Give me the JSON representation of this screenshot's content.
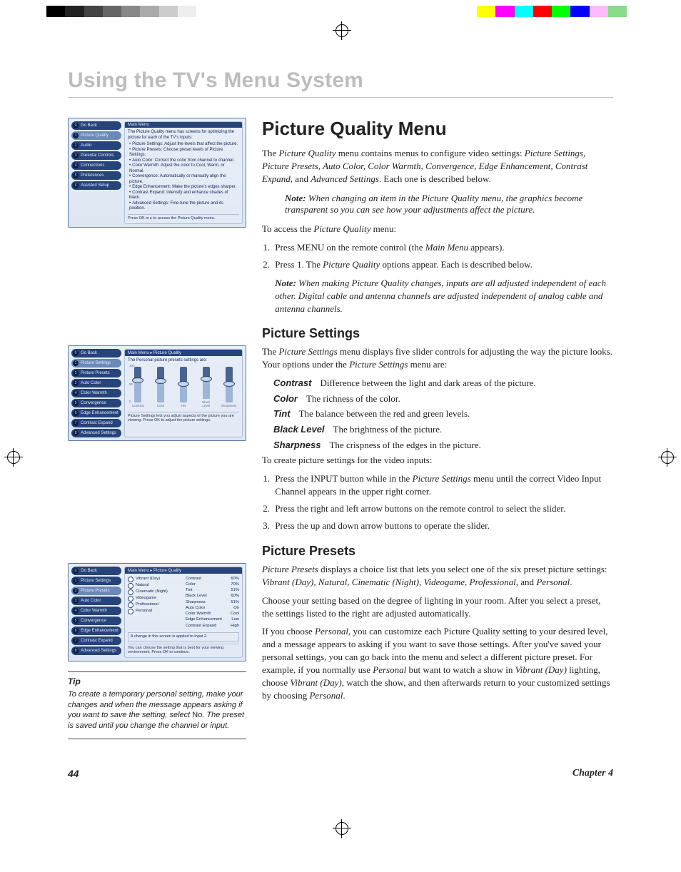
{
  "chapter_heading": "Using the TV's Menu System",
  "h1": "Picture Quality Menu",
  "intro": {
    "pre": "The ",
    "m1": "Picture Quality",
    "mid1": " menu contains menus to configure video settings: ",
    "m2": "Picture Settings, Picture Presets, Auto Color, Color Warmth, Convergence, Edge Enhancement, Contrast Expand,",
    "mid2": " and ",
    "m3": "Advanced Settings",
    "end": ". Each one is described below."
  },
  "note1_label": "Note:",
  "note1": "When changing an item in the Picture Quality menu, the graphics become transparent so you can see how your adjustments affect the picture.",
  "access_line_pre": "To access the ",
  "access_line_m": "Picture Quality",
  "access_line_post": " menu:",
  "steps1": {
    "s1_pre": "Press MENU on the remote control (the ",
    "s1_m": "Main Menu",
    "s1_post": " appears).",
    "s2_pre": "Press 1. The ",
    "s2_m": "Picture Quality",
    "s2_post": " options appear. Each is described below."
  },
  "note2_label": "Note:",
  "note2": "When making Picture Quality changes, inputs are all adjusted independent of each other. Digital cable and antenna channels are adjusted independent of analog cable and antenna channels.",
  "h2a": "Picture Settings",
  "ps_p1_pre": "The ",
  "ps_p1_m": "Picture Settings",
  "ps_p1_mid": " menu displays five slider controls for adjusting the way the picture looks. Your options under the ",
  "ps_p1_m2": "Picture Settings",
  "ps_p1_post": " menu are:",
  "defs": {
    "contrast_t": "Contrast",
    "contrast_d": "Difference between the light and dark areas of the picture.",
    "color_t": "Color",
    "color_d": "The richness of the color.",
    "tint_t": "Tint",
    "tint_d": "The balance between the red and green levels.",
    "black_t": "Black Level",
    "black_d": "The brightness of the picture.",
    "sharp_t": "Sharpness",
    "sharp_d": "The crispness of the edges in the picture."
  },
  "ps_line2": "To create picture settings for the video inputs:",
  "steps2": {
    "s1_pre": "Press the INPUT button while in the ",
    "s1_m": "Picture Settings",
    "s1_post": " menu until the correct Video Input Channel appears in the upper right corner.",
    "s2": "Press the right and left arrow buttons on the remote control to select the slider.",
    "s3": "Press the up and down arrow buttons to operate the slider."
  },
  "h2b": "Picture Presets",
  "pp_p1_pre": "",
  "pp_p1_m": "Picture Presets",
  "pp_p1_mid": " displays a choice list that lets you select one of the six preset picture settings: ",
  "pp_p1_m2": "Vibrant (Day), Natural, Cinematic (Night), Videogame, Professional,",
  "pp_p1_mid2": " and ",
  "pp_p1_m3": "Personal",
  "pp_p1_end": ".",
  "pp_p2": "Choose your setting based on the degree of lighting in your room. After you select a preset, the settings listed to the right are adjusted automatically.",
  "pp_p3_a": "If you choose ",
  "pp_p3_m1": "Personal",
  "pp_p3_b": ", you can customize each Picture Quality setting to your desired level, and a message appears to asking if you want to save those settings. After you've saved your personal settings, you can go back into the menu and select a different picture preset. For example, if you normally use ",
  "pp_p3_m2": "Personal",
  "pp_p3_c": " but want to watch a show in ",
  "pp_p3_m3": "Vibrant (Day)",
  "pp_p3_d": " lighting, choose ",
  "pp_p3_m4": "Vibrant (Day)",
  "pp_p3_e": ", watch the show, and then afterwards return to your customized settings by choosing ",
  "pp_p3_m5": "Personal",
  "pp_p3_f": ".",
  "tip_title": "Tip",
  "tip_body_a": "To create a temporary personal setting, make your changes and when the message appears asking if you want to save the setting, select ",
  "tip_body_no": "No",
  "tip_body_b": ". The preset is saved until you change the channel or input.",
  "panel1": {
    "breadcrumb": "Main Menu",
    "nav": [
      "Go Back",
      "Picture Quality",
      "Audio",
      "Parental Controls",
      "Connections",
      "Preferences",
      "Assisted Setup"
    ],
    "info_line": "The Picture Quality menu has screens for optimizing the picture for each of the TV's inputs:",
    "bullets": [
      "Picture Settings: Adjust the levels that affect the picture.",
      "Picture Presets: Choose preset levels of Picture Settings.",
      "Auto Color: Correct the color from channel to channel.",
      "Color Warmth: Adjust the color to Cool, Warm, or Normal.",
      "Convergence: Automatically or manually align the picture.",
      "Edge Enhancement: Make the picture's edges sharper.",
      "Contrast Expand: Intensify and enhance shades of black.",
      "Advanced Settings: Fine-tune the picture and its position."
    ],
    "footer": "Press OK or ▸ to access the Picture Quality menu."
  },
  "panel2": {
    "breadcrumb": "Main Menu ▸ Picture Quality",
    "nav": [
      "Go Back",
      "Picture Settings",
      "Picture Presets",
      "Auto Color",
      "Color Warmth",
      "Convergence",
      "Edge Enhancement",
      "Contrast Expand",
      "Advanced Settings"
    ],
    "info_line": "The Personal picture presets settings are:",
    "sliders": [
      {
        "label": "Contrast",
        "value": 60
      },
      {
        "label": "Color",
        "value": 59
      },
      {
        "label": "Tint",
        "value": 50
      },
      {
        "label": "Black Level",
        "value": 60
      },
      {
        "label": "Sharpness",
        "value": 50
      }
    ],
    "axis_top": "100",
    "axis_mid": "50",
    "axis_bot": "0",
    "footer": "Picture Settings lets you adjust aspects of the picture you are viewing. Press OK to adjust the picture settings."
  },
  "panel3": {
    "breadcrumb": "Main Menu ▸ Picture Quality",
    "nav": [
      "Go Back",
      "Picture Settings",
      "Picture Presets",
      "Auto Color",
      "Color Warmth",
      "Convergence",
      "Edge Enhancement",
      "Contrast Expand",
      "Advanced Settings"
    ],
    "presets": [
      "Vibrant (Day)",
      "Natural",
      "Cinematic (Night)",
      "Videogame",
      "Professional",
      "Personal"
    ],
    "values": [
      [
        "Contrast",
        "60%"
      ],
      [
        "Color",
        "70%"
      ],
      [
        "Tint",
        "51%"
      ],
      [
        "Black Level",
        "60%"
      ],
      [
        "Sharpness",
        "51%"
      ],
      [
        "Auto Color",
        "On"
      ],
      [
        "Color Warmth",
        "Cool"
      ],
      [
        "Edge Enhancement",
        "Low"
      ],
      [
        "Contrast Expand",
        "High"
      ]
    ],
    "foot1": "A change in this screen is applied to Input 2.",
    "foot2": "You can choose the setting that is best for your viewing environment. Press OK to continue."
  },
  "footer": {
    "page": "44",
    "chapter": "Chapter 4"
  },
  "colorbar_left": [
    "#000",
    "#222",
    "#444",
    "#666",
    "#888",
    "#aaa",
    "#ccc",
    "#eee"
  ],
  "colorbar_right": [
    "#ff0",
    "#f0f",
    "#0ff",
    "#f00",
    "#0f0",
    "#00f",
    "#fbf",
    "#8d8"
  ]
}
